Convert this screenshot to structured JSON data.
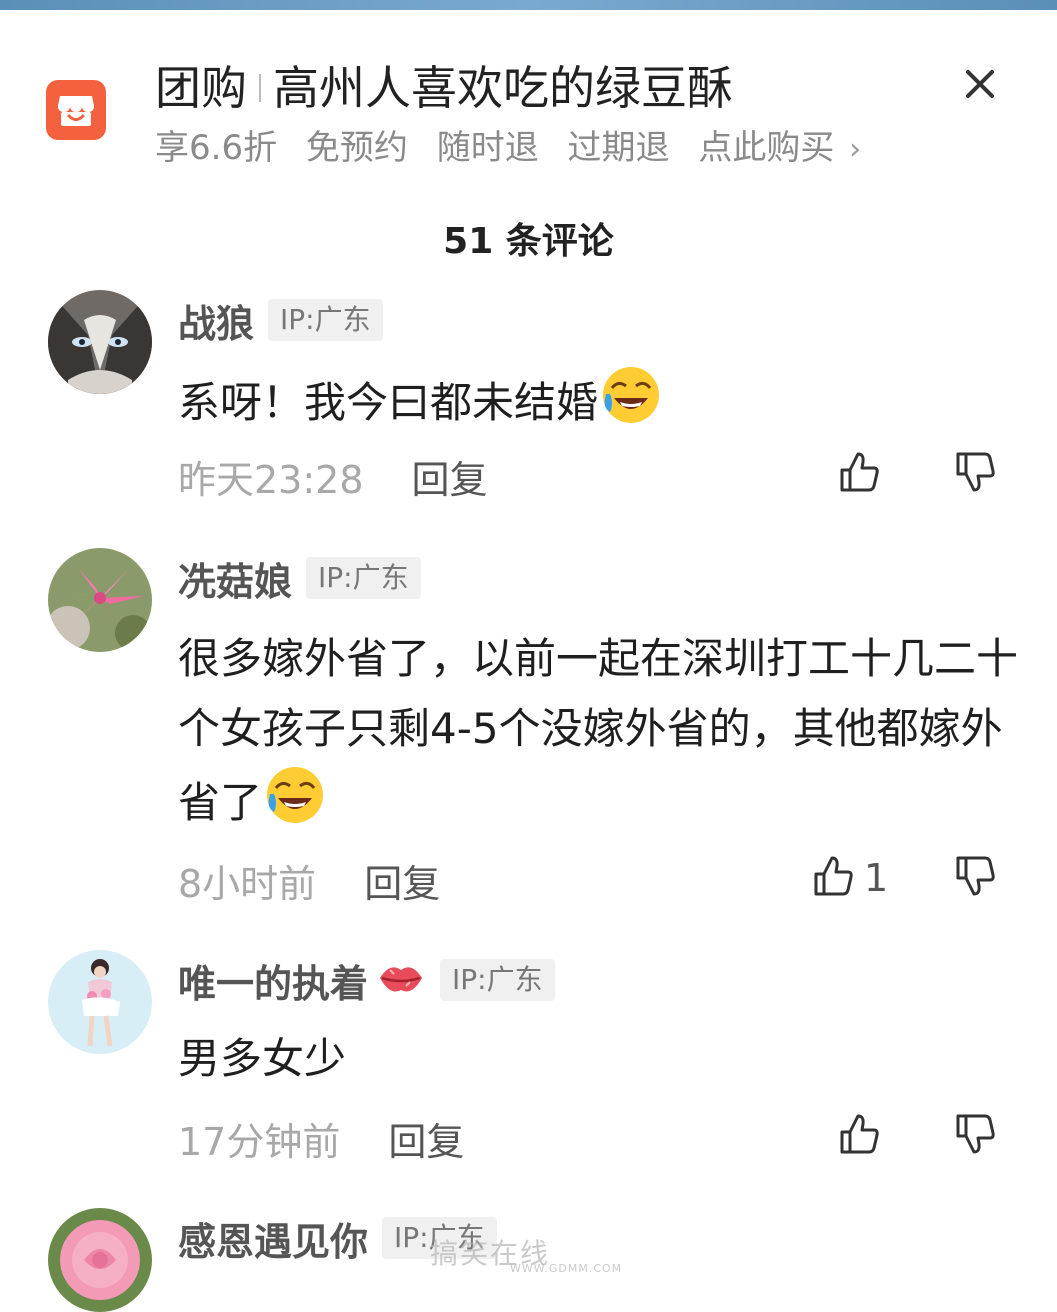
{
  "banner": {
    "category": "团购",
    "product": "高州人喜欢吃的绿豆酥",
    "tags": [
      "享6.6折",
      "免预约",
      "随时退",
      "过期退",
      "点此购买"
    ],
    "chevron": "›"
  },
  "comment_count_label": "51 条评论",
  "comments": [
    {
      "user": "战狼",
      "ip": "IP:广东",
      "text": "系呀！我今曰都未结婚",
      "emoji": "laugh-cry",
      "time": "昨天23:28",
      "reply": "回复",
      "likes": ""
    },
    {
      "user": "冼菇娘",
      "ip": "IP:广东",
      "text": "很多嫁外省了，以前一起在深圳打工十几二十个女孩子只剩4-5个没嫁外省的，其他都嫁外省了",
      "emoji": "laugh-cry",
      "time": "8小时前",
      "reply": "回复",
      "likes": "1"
    },
    {
      "user": "唯一的执着",
      "ip": "IP:广东",
      "text": "男多女少",
      "emoji": "",
      "time": "17分钟前",
      "reply": "回复",
      "likes": ""
    },
    {
      "user": "感恩遇见你",
      "ip": "IP:广东",
      "text": "",
      "time": "",
      "reply": "",
      "likes": ""
    }
  ],
  "watermark": {
    "main": "搞笑在线",
    "sub": "WWW.GDMM.COM"
  },
  "icons": {
    "shop": "shop-icon",
    "close": "close-icon",
    "like": "thumbs-up-icon",
    "dislike": "thumbs-down-icon"
  }
}
